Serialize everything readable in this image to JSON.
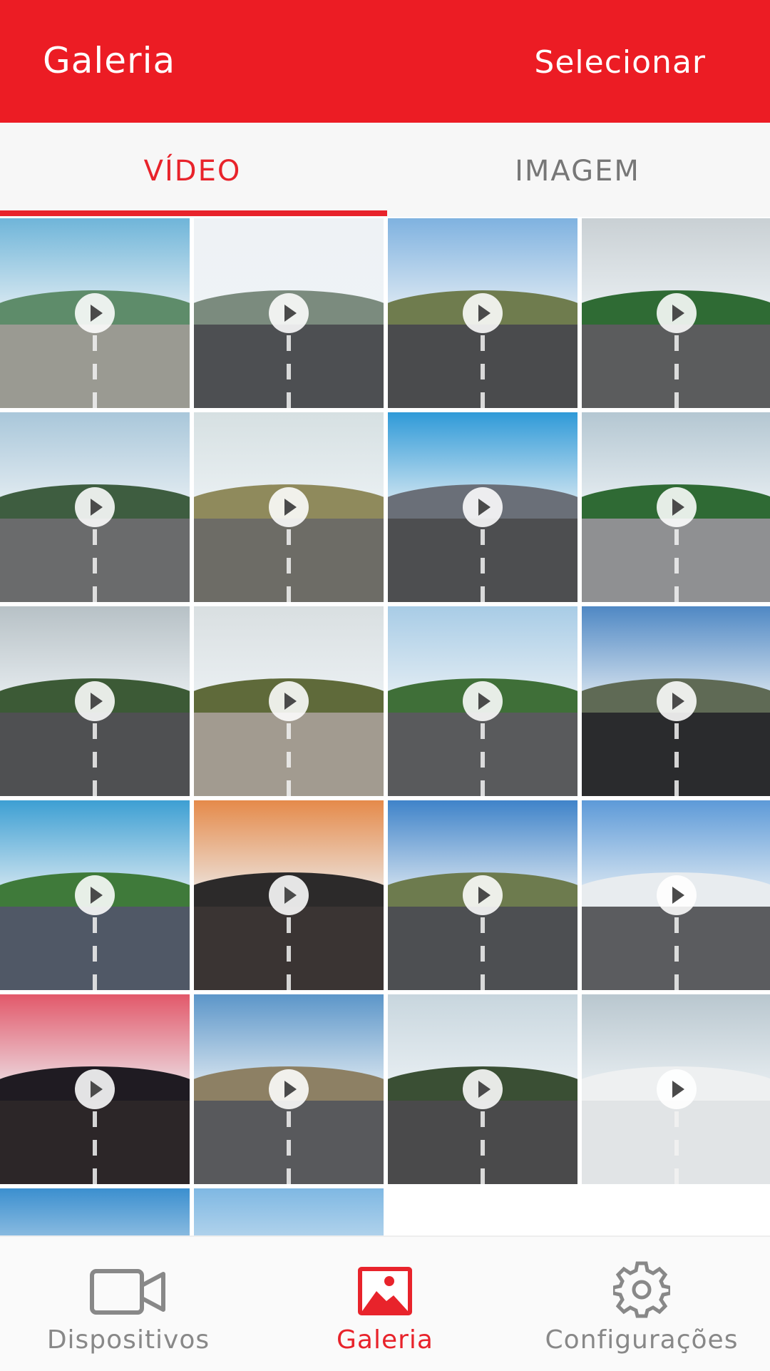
{
  "header": {
    "title": "Galeria",
    "select_label": "Selecionar"
  },
  "tabs": [
    {
      "label": "VÍDEO",
      "active": true
    },
    {
      "label": "IMAGEM",
      "active": false
    }
  ],
  "gallery": {
    "item_icon": "play-icon",
    "items": [
      {
        "name": "video-thumb-1",
        "sky": "#6fb5d9",
        "hill": "#5e8c6a",
        "road": "#9a9a92"
      },
      {
        "name": "video-thumb-2",
        "sky": "#eef2f5",
        "hill": "#7b8b7e",
        "road": "#4d4f52"
      },
      {
        "name": "video-thumb-3",
        "sky": "#7fb2e0",
        "hill": "#6f7c4e",
        "road": "#4a4b4d"
      },
      {
        "name": "video-thumb-4",
        "sky": "#c9d0d4",
        "hill": "#2f6b34",
        "road": "#5b5c5d"
      },
      {
        "name": "video-thumb-5",
        "sky": "#a9c7da",
        "hill": "#3e5d40",
        "road": "#6a6b6c"
      },
      {
        "name": "video-thumb-6",
        "sky": "#d6e0e2",
        "hill": "#8f8a5c",
        "road": "#6d6c66"
      },
      {
        "name": "video-thumb-7",
        "sky": "#2f9ad8",
        "hill": "#6a6f78",
        "road": "#4d4e50"
      },
      {
        "name": "video-thumb-8",
        "sky": "#b4c7d2",
        "hill": "#2f6a34",
        "road": "#8f9092"
      },
      {
        "name": "video-thumb-9",
        "sky": "#b7c1c6",
        "hill": "#3c5a36",
        "road": "#4f5052"
      },
      {
        "name": "video-thumb-10",
        "sky": "#d9dfe1",
        "hill": "#5f6a3a",
        "road": "#a29b90"
      },
      {
        "name": "video-thumb-11",
        "sky": "#a8cce6",
        "hill": "#3f6f38",
        "road": "#595a5c"
      },
      {
        "name": "video-thumb-12",
        "sky": "#4f88c4",
        "hill": "#5f6a55",
        "road": "#2a2b2d"
      },
      {
        "name": "video-thumb-13",
        "sky": "#3d9fd3",
        "hill": "#3f7a3a",
        "road": "#505866"
      },
      {
        "name": "video-thumb-14",
        "sky": "#e58a4a",
        "hill": "#2c2a2a",
        "road": "#3a3433"
      },
      {
        "name": "video-thumb-15",
        "sky": "#3f83c9",
        "hill": "#6d7b4e",
        "road": "#4d4f52"
      },
      {
        "name": "video-thumb-16",
        "sky": "#5d9ad8",
        "hill": "#e8ecef",
        "road": "#5b5c5f"
      },
      {
        "name": "video-thumb-17",
        "sky": "#e2586a",
        "hill": "#1f1b22",
        "road": "#2c2628"
      },
      {
        "name": "video-thumb-18",
        "sky": "#5c96c9",
        "hill": "#8d8064",
        "road": "#58595c"
      },
      {
        "name": "video-thumb-19",
        "sky": "#c8d6de",
        "hill": "#3a4f34",
        "road": "#4a4a4b"
      },
      {
        "name": "video-thumb-20",
        "sky": "#b9c7cf",
        "hill": "#eef0f1",
        "road": "#e1e4e6"
      },
      {
        "name": "video-thumb-21",
        "sky": "#3b8fcf",
        "hill": "#7a6a4e",
        "road": "#5a5a5a"
      },
      {
        "name": "video-thumb-22",
        "sky": "#7fb8e3",
        "hill": "#9a7a4e",
        "road": "#5a5a5a"
      }
    ]
  },
  "bottom_nav": [
    {
      "label": "Dispositivos",
      "icon": "video-camera-icon",
      "active": false
    },
    {
      "label": "Galeria",
      "icon": "image-icon",
      "active": true
    },
    {
      "label": "Configurações",
      "icon": "gear-icon",
      "active": false
    }
  ],
  "colors": {
    "accent": "#ec1c24",
    "inactive": "#888888"
  }
}
